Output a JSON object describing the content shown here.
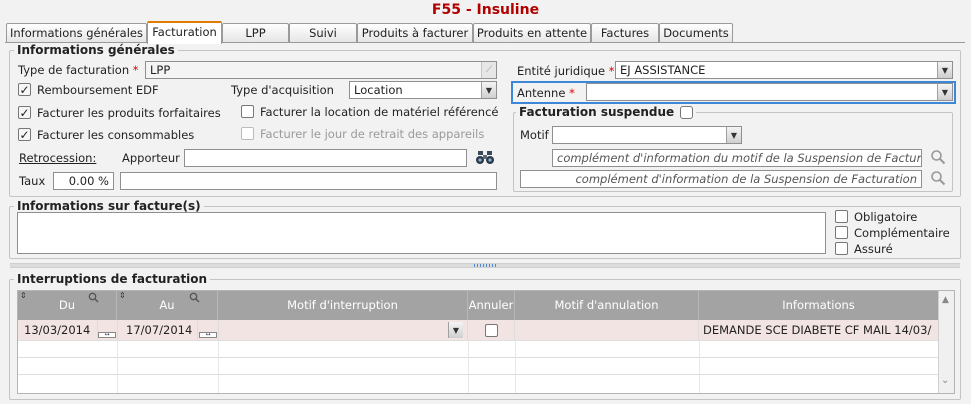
{
  "window": {
    "title": "F55 - Insuline"
  },
  "tabs": [
    {
      "label": "Informations générales"
    },
    {
      "label": "Facturation"
    },
    {
      "label": "LPP"
    },
    {
      "label": "Suivi"
    },
    {
      "label": "Produits à facturer"
    },
    {
      "label": "Produits en attente"
    },
    {
      "label": "Factures"
    },
    {
      "label": "Documents"
    }
  ],
  "active_tab": "Facturation",
  "general": {
    "legend": "Informations générales",
    "type_facturation": {
      "label": "Type de facturation",
      "required": "*",
      "value": "LPP"
    },
    "remboursement_edf": {
      "label": "Remboursement EDF",
      "checked": true
    },
    "type_acquisition": {
      "label": "Type d'acquisition",
      "value": "Location"
    },
    "facturer_forfaitaires": {
      "label": "Facturer les produits forfaitaires",
      "checked": true
    },
    "facturer_location": {
      "label": "Facturer la location de matériel référencé",
      "checked": false
    },
    "facturer_consommables": {
      "label": "Facturer les consommables",
      "checked": true
    },
    "facturer_retrait": {
      "label": "Facturer le jour de retrait des appareils",
      "checked": false,
      "disabled": true
    },
    "retrocession": {
      "label": "Retrocession:"
    },
    "apporteur": {
      "label": "Apporteur",
      "value": ""
    },
    "taux": {
      "label": "Taux",
      "value": "0.00 %",
      "extra": ""
    },
    "entite_juridique": {
      "label": "Entité juridique",
      "required": "*",
      "value": "EJ ASSISTANCE"
    },
    "antenne": {
      "label": "Antenne",
      "required": "*",
      "value": ""
    }
  },
  "suspension": {
    "legend": "Facturation suspendue",
    "checked": false,
    "motif": {
      "label": "Motif",
      "value": ""
    },
    "complement_motif_placeholder": "complément d'information du motif de la Suspension de Factura",
    "complement_placeholder": "complément d'information de la Suspension de Facturation"
  },
  "invoice_info": {
    "legend": "Informations sur facture(s)",
    "text": "",
    "obligatoire": {
      "label": "Obligatoire",
      "checked": false
    },
    "complementaire": {
      "label": "Complémentaire",
      "checked": false
    },
    "assure": {
      "label": "Assuré",
      "checked": false
    }
  },
  "interruptions": {
    "legend": "Interruptions de facturation",
    "columns": {
      "du": "Du",
      "au": "Au",
      "motif_interruption": "Motif d'interruption",
      "annuler": "Annuler",
      "motif_annulation": "Motif d'annulation",
      "informations": "Informations"
    },
    "rows": [
      {
        "du": "13/03/2014",
        "au": "17/07/2014",
        "motif": "",
        "annuler": false,
        "motif_annulation": "",
        "informations": "DEMANDE SCE DIABETE CF MAIL 14/03/"
      }
    ]
  },
  "colors": {
    "title": "#b00000",
    "active_tab_accent": "#e07b00",
    "focus_border": "#3c88d6",
    "grid_header": "#a3a3a3",
    "grid_row": "#f2e4e2",
    "required": "#d00000"
  },
  "icons": {
    "binoculars": "binoculars-icon",
    "search": "magnifier-icon",
    "calendar": "calendar-icon",
    "dropdown": "chevron-down-icon"
  }
}
